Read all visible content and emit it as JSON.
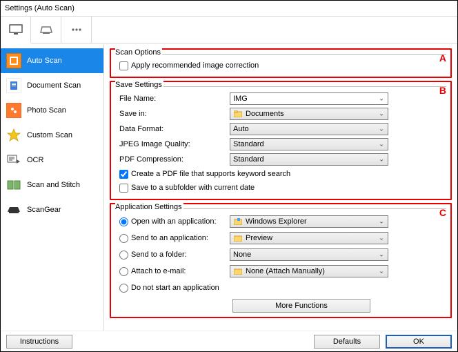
{
  "window": {
    "title": "Settings (Auto Scan)"
  },
  "sidebar": {
    "items": [
      {
        "label": "Auto Scan"
      },
      {
        "label": "Document Scan"
      },
      {
        "label": "Photo Scan"
      },
      {
        "label": "Custom Scan"
      },
      {
        "label": "OCR"
      },
      {
        "label": "Scan and Stitch"
      },
      {
        "label": "ScanGear"
      }
    ]
  },
  "regionA": {
    "legend": "Scan Options",
    "letter": "A",
    "apply_correction": "Apply recommended image correction"
  },
  "regionB": {
    "legend": "Save Settings",
    "letter": "B",
    "file_name_label": "File Name:",
    "file_name_value": "IMG",
    "save_in_label": "Save in:",
    "save_in_value": "Documents",
    "data_format_label": "Data Format:",
    "data_format_value": "Auto",
    "jpeg_label": "JPEG Image Quality:",
    "jpeg_value": "Standard",
    "pdf_comp_label": "PDF Compression:",
    "pdf_comp_value": "Standard",
    "pdf_keyword": "Create a PDF file that supports keyword search",
    "subfolder": "Save to a subfolder with current date"
  },
  "regionC": {
    "legend": "Application Settings",
    "letter": "C",
    "open_with_label": "Open with an application:",
    "open_with_value": "Windows Explorer",
    "send_app_label": "Send to an application:",
    "send_app_value": "Preview",
    "send_folder_label": "Send to a folder:",
    "send_folder_value": "None",
    "attach_label": "Attach to e-mail:",
    "attach_value": "None (Attach Manually)",
    "do_not_start": "Do not start an application",
    "more_functions": "More Functions"
  },
  "buttons": {
    "instructions": "Instructions",
    "defaults": "Defaults",
    "ok": "OK"
  }
}
